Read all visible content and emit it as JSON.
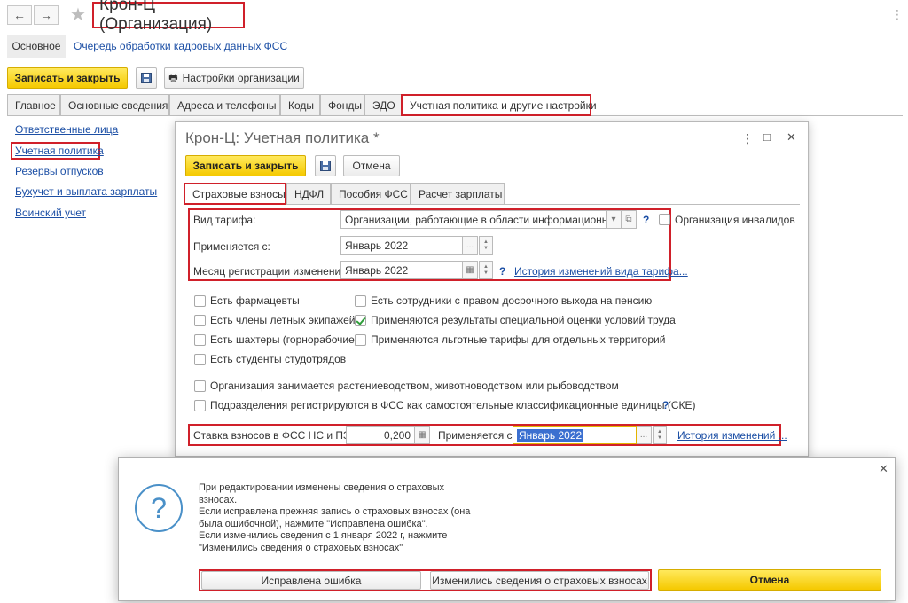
{
  "main_window": {
    "title": "Крон-Ц (Организация)",
    "nav": {
      "back": "←",
      "forward": "→",
      "favorite": "★"
    },
    "section_tabs": [
      {
        "label": "Основное"
      },
      {
        "label": "Очередь обработки кадровых данных ФСС"
      }
    ],
    "toolbar": {
      "save_close": "Записать и закрыть",
      "settings": "Настройки организации"
    },
    "tabs": [
      "Главное",
      "Основные сведения",
      "Адреса и телефоны",
      "Коды",
      "Фонды",
      "ЭДО",
      "Учетная политика и другие настройки"
    ],
    "side_links": [
      "Ответственные лица",
      "Учетная политика",
      "Резервы отпусков",
      "Бухучет и выплата зарплаты",
      "Воинский учет"
    ]
  },
  "policy_window": {
    "title": "Крон-Ц: Учетная политика *",
    "controls": {
      "more": "⋮",
      "maximize": "□",
      "close": "✕"
    },
    "toolbar": {
      "save_close": "Записать и закрыть",
      "cancel": "Отмена"
    },
    "tabs": [
      "Страховые взносы",
      "НДФЛ",
      "Пособия ФСС",
      "Расчет зарплаты"
    ],
    "tariff_label": "Вид тарифа:",
    "tariff_value": "Организации, работающие в области информационных те",
    "disabled_org_label": "Организация инвалидов",
    "applies_from_label": "Применяется с:",
    "applies_from_value": "Январь 2022",
    "reg_month_label": "Месяц регистрации изменений:",
    "reg_month_value": "Январь 2022",
    "tariff_history_link": "История изменений вида тарифа...",
    "help_mark": "?",
    "checkboxes_left": [
      {
        "label": "Есть фармацевты",
        "checked": false
      },
      {
        "label": "Есть члены летных экипажей",
        "checked": false
      },
      {
        "label": "Есть шахтеры (горнорабочие)",
        "checked": false
      },
      {
        "label": "Есть студенты студотрядов",
        "checked": false
      }
    ],
    "checkboxes_right": [
      {
        "label": "Есть сотрудники с правом досрочного выхода на пенсию",
        "checked": false
      },
      {
        "label": "Применяются результаты специальной оценки условий труда",
        "checked": true
      },
      {
        "label": "Применяются льготные тарифы для отдельных территорий",
        "checked": false
      }
    ],
    "checkbox_agri": "Организация занимается растениеводством, животноводством или рыбоводством",
    "checkbox_units": "Подразделения регистрируются в ФСС как самостоятельные классификационные единицы (СКЕ)",
    "fss_rate_label": "Ставка взносов в ФСС НС и ПЗ:",
    "fss_rate_value": "0,200",
    "fss_applies_label": "Применяется с:",
    "fss_applies_value": "Январь 2022",
    "fss_history_link": "История изменений ..."
  },
  "dialog": {
    "icon": "question-icon",
    "message_lines": [
      "При редактировании изменены сведения о страховых",
      "взносах.",
      "Если исправлена прежняя запись о страховых взносах (она",
      "была ошибочной), нажмите \"Исправлена ошибка\".",
      "Если изменились сведения с 1 января 2022 г, нажмите",
      "\"Изменились сведения о страховых взносах\""
    ],
    "btn_fixed": "Исправлена ошибка",
    "btn_changed": "Изменились сведения о страховых взносах",
    "btn_cancel": "Отмена",
    "close": "✕"
  },
  "colors": {
    "highlight_red": "#d0202a",
    "accent_yellow": "#f5c900",
    "link_blue": "#1c4fa5"
  }
}
